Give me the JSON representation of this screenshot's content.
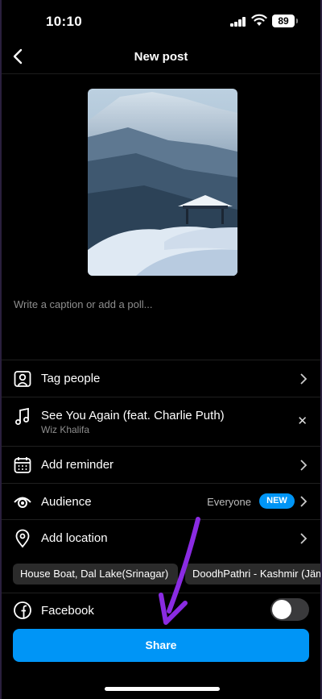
{
  "status_bar": {
    "time": "10:10",
    "battery": "89"
  },
  "header": {
    "title": "New post"
  },
  "caption": {
    "placeholder": "Write a caption or add a poll..."
  },
  "options": {
    "tag_people": "Tag people",
    "music_title": "See You Again (feat. Charlie Puth)",
    "music_artist": "Wiz Khalifa",
    "add_reminder": "Add reminder",
    "audience": "Audience",
    "audience_value": "Everyone",
    "audience_badge": "NEW",
    "add_location": "Add location",
    "facebook": "Facebook"
  },
  "location_suggestions": [
    "House Boat, Dal Lake(Srinagar)",
    "DoodhPathri - Kashmir (Jäm"
  ],
  "share_label": "Share",
  "colors": {
    "accent": "#0095f6",
    "annotation_arrow": "#8a2be2"
  }
}
